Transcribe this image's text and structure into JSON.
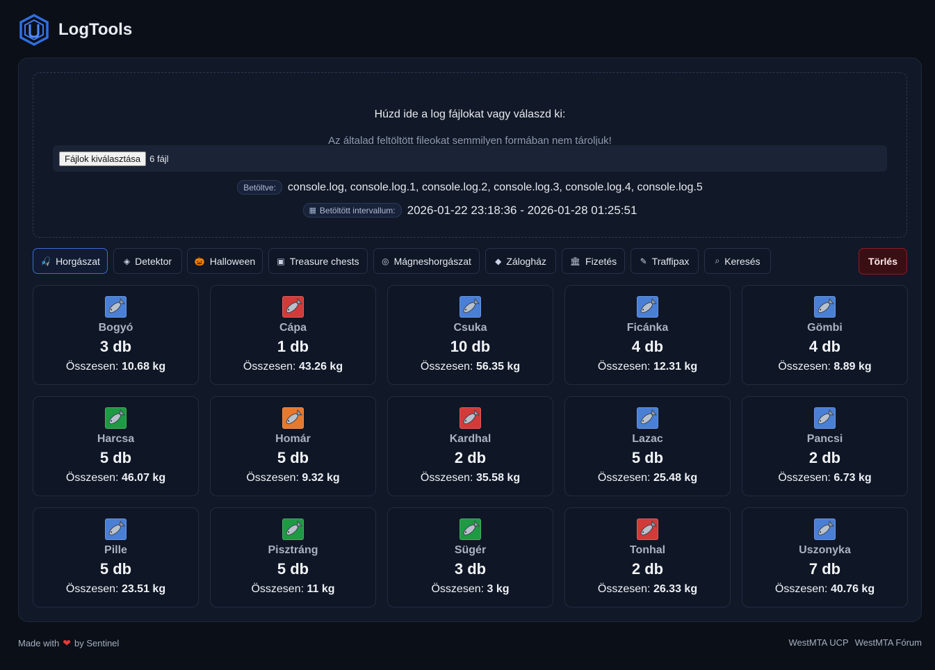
{
  "header": {
    "brand": "LogTools"
  },
  "upload": {
    "title": "Húzd ide a log fájlokat vagy válaszd ki:",
    "subtitle": "Az általad feltöltött fileokat semmilyen formában nem tároljuk!",
    "choose_button": "Fájlok kiválasztása",
    "file_count": "6 fájl",
    "loaded_label": "Betöltve:",
    "loaded_files": "console.log, console.log.1, console.log.2, console.log.3, console.log.4, console.log.5",
    "interval_label": "Betöltött intervallum:",
    "interval_value": "2026-01-22 23:18:36 - 2026-01-28 01:25:51"
  },
  "tabs": [
    {
      "label": "Horgászat",
      "icon": "fishing-icon",
      "glyph": "🎣",
      "active": true
    },
    {
      "label": "Detektor",
      "icon": "detector-icon",
      "glyph": "◈",
      "active": false
    },
    {
      "label": "Halloween",
      "icon": "pumpkin-icon",
      "glyph": "🎃",
      "active": false
    },
    {
      "label": "Treasure chests",
      "icon": "chest-icon",
      "glyph": "▣",
      "active": false
    },
    {
      "label": "Mágneshorgászat",
      "icon": "magnet-icon",
      "glyph": "◎",
      "active": false
    },
    {
      "label": "Zálogház",
      "icon": "pawn-icon",
      "glyph": "◆",
      "active": false
    },
    {
      "label": "Fizetés",
      "icon": "bank-icon",
      "glyph": "🏛",
      "active": false
    },
    {
      "label": "Traffipax",
      "icon": "speed-camera-icon",
      "glyph": "✎",
      "active": false
    },
    {
      "label": "Keresés",
      "icon": "search-icon",
      "glyph": "⌕",
      "active": false
    }
  ],
  "delete_button": "Törlés",
  "fish": [
    {
      "name": "Bogyó",
      "count": "3 db",
      "total_label": "Összesen:",
      "total": "10.68 kg",
      "color": "#4a7fd6"
    },
    {
      "name": "Cápa",
      "count": "1 db",
      "total_label": "Összesen:",
      "total": "43.26 kg",
      "color": "#d33a3a"
    },
    {
      "name": "Csuka",
      "count": "10 db",
      "total_label": "Összesen:",
      "total": "56.35 kg",
      "color": "#4a7fd6"
    },
    {
      "name": "Ficánka",
      "count": "4 db",
      "total_label": "Összesen:",
      "total": "12.31 kg",
      "color": "#4a7fd6"
    },
    {
      "name": "Gömbi",
      "count": "4 db",
      "total_label": "Összesen:",
      "total": "8.89 kg",
      "color": "#4a7fd6"
    },
    {
      "name": "Harcsa",
      "count": "5 db",
      "total_label": "Összesen:",
      "total": "46.07 kg",
      "color": "#1f9a44"
    },
    {
      "name": "Homár",
      "count": "5 db",
      "total_label": "Összesen:",
      "total": "9.32 kg",
      "color": "#e8782c"
    },
    {
      "name": "Kardhal",
      "count": "2 db",
      "total_label": "Összesen:",
      "total": "35.58 kg",
      "color": "#d33a3a"
    },
    {
      "name": "Lazac",
      "count": "5 db",
      "total_label": "Összesen:",
      "total": "25.48 kg",
      "color": "#4a7fd6"
    },
    {
      "name": "Pancsi",
      "count": "2 db",
      "total_label": "Összesen:",
      "total": "6.73 kg",
      "color": "#4a7fd6"
    },
    {
      "name": "Pille",
      "count": "5 db",
      "total_label": "Összesen:",
      "total": "23.51 kg",
      "color": "#4a7fd6"
    },
    {
      "name": "Pisztráng",
      "count": "5 db",
      "total_label": "Összesen:",
      "total": "11 kg",
      "color": "#1f9a44"
    },
    {
      "name": "Sügér",
      "count": "3 db",
      "total_label": "Összesen:",
      "total": "3 kg",
      "color": "#1f9a44"
    },
    {
      "name": "Tonhal",
      "count": "2 db",
      "total_label": "Összesen:",
      "total": "26.33 kg",
      "color": "#d33a3a"
    },
    {
      "name": "Uszonyka",
      "count": "7 db",
      "total_label": "Összesen:",
      "total": "40.76 kg",
      "color": "#4a7fd6"
    }
  ],
  "footer": {
    "made_with": "Made with",
    "by": "by Sentinel",
    "links": [
      "WestMTA UCP",
      "WestMTA Fórum"
    ]
  }
}
